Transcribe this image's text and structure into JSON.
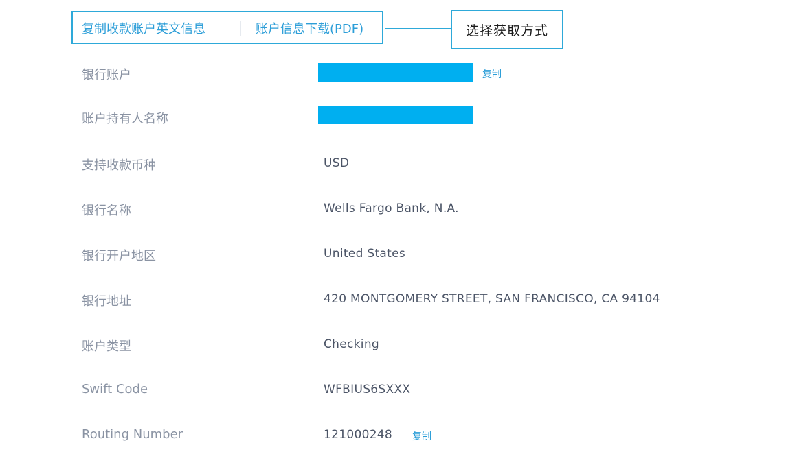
{
  "actions": {
    "copy_english_info": "复制收款账户英文信息",
    "download_pdf": "账户信息下载(PDF)"
  },
  "annotation": {
    "callout_text": "选择获取方式"
  },
  "colors": {
    "accent": "#2c9ed8",
    "annotation_border": "#2ea9d9",
    "redaction": "#00aff0",
    "label": "#8a93a3",
    "value": "#4b5466"
  },
  "fields": [
    {
      "label": "银行账户",
      "value": "",
      "redacted": true,
      "copy_label": "复制"
    },
    {
      "label": "账户持有人名称",
      "value": "",
      "redacted": true
    },
    {
      "label": "支持收款币种",
      "value": "USD"
    },
    {
      "label": "银行名称",
      "value": "Wells Fargo Bank, N.A."
    },
    {
      "label": "银行开户地区",
      "value": "United States"
    },
    {
      "label": "银行地址",
      "value": "420 MONTGOMERY STREET, SAN FRANCISCO, CA 94104"
    },
    {
      "label": "账户类型",
      "value": "Checking"
    },
    {
      "label": "Swift Code",
      "value": "WFBIUS6SXXX"
    },
    {
      "label": "Routing Number",
      "value": "121000248",
      "copy_label": "复制"
    }
  ]
}
